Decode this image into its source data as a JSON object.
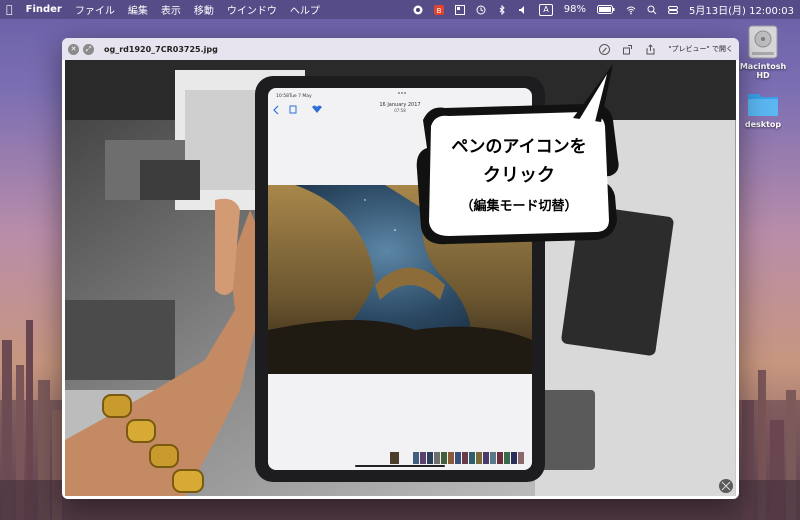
{
  "menubar": {
    "app_name": "Finder",
    "menus": [
      "ファイル",
      "編集",
      "表示",
      "移動",
      "ウインドウ",
      "ヘルプ"
    ],
    "battery_percent": "98%",
    "input_source": "A",
    "datetime": "5月13日(月) 12:00:03"
  },
  "desktop": {
    "icons": [
      {
        "label": "Macintosh HD",
        "icon": "hard-drive-icon"
      },
      {
        "label": "desktop",
        "icon": "folder-icon"
      }
    ]
  },
  "window": {
    "title": "og_rd1920_7CR03725.jpg",
    "open_with_label": "\"プレビュー\" で開く",
    "toolbar_icons": [
      "markup-pen-icon",
      "rotate-icon",
      "share-icon"
    ]
  },
  "callout": {
    "line1": "ペンのアイコンを",
    "line2": "クリック",
    "line3": "（編集モード切替）"
  },
  "ipad": {
    "status_time": "10:58",
    "status_date": "Tue 7 May",
    "photo_date": "16 January 2017",
    "photo_time": "07:58"
  },
  "colors": {
    "menubar": "#463c6e",
    "titlebar": "#e8e4ef",
    "ipad_accent": "#2f6fd6"
  }
}
